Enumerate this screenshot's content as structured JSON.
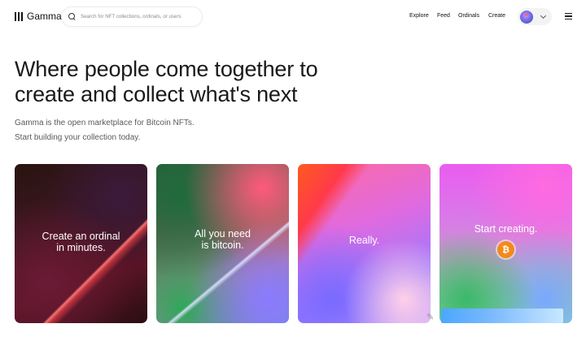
{
  "header": {
    "brand": "Gamma",
    "search_placeholder": "Search for NFT collections, ordinals, or users",
    "nav": [
      "Explore",
      "Feed",
      "Ordinals",
      "Create"
    ]
  },
  "hero": {
    "title": "Where people come together to create and collect what's next",
    "subtitle_line1": "Gamma is the open marketplace for Bitcoin NFTs.",
    "subtitle_line2": "Start building your collection today."
  },
  "cards": [
    {
      "text": "Create an ordinal\nin minutes."
    },
    {
      "text": "All you need\nis bitcoin."
    },
    {
      "text": "Really."
    },
    {
      "text": "Start creating.",
      "icon": "bitcoin-icon",
      "icon_glyph": "₿",
      "icon_color": "#f28a1a"
    }
  ],
  "icons": {
    "logo": "gamma-logo-icon",
    "search": "search-icon",
    "avatar": "avatar",
    "dropdown": "chevron-down-icon",
    "menu": "hamburger-menu-icon"
  }
}
